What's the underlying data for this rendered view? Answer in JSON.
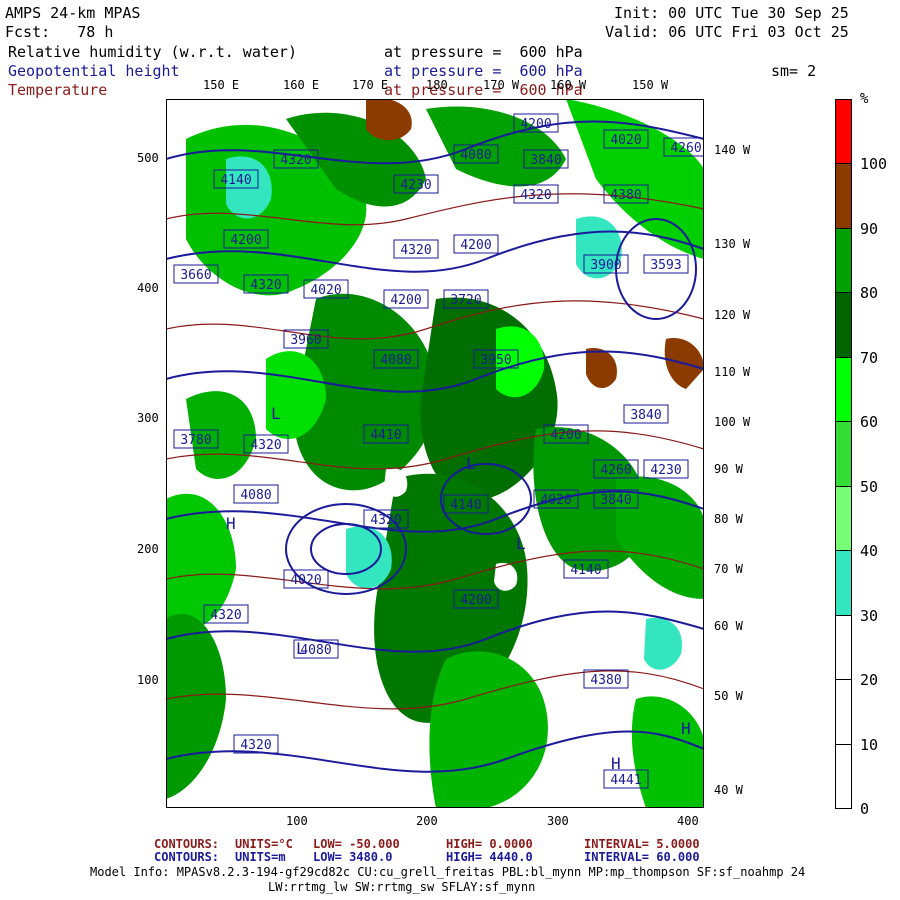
{
  "header": {
    "title": "AMPS 24-km MPAS",
    "fcst": "Fcst:   78 h",
    "init": "Init: 00 UTC Tue 30 Sep 25",
    "valid": "Valid: 06 UTC Fri 03 Oct 25",
    "sm": "sm= 2"
  },
  "fields": [
    {
      "name": "Relative humidity (w.r.t. water)",
      "level": "at pressure =  600 hPa",
      "color": "#000000"
    },
    {
      "name": "Geopotential height",
      "level": "at pressure =  600 hPa",
      "color": "#1a1a9a"
    },
    {
      "name": "Temperature",
      "level": "at pressure =  600 hPa",
      "color": "#8b1a1a"
    }
  ],
  "axes": {
    "x_ticks": [
      "100",
      "200",
      "300",
      "400"
    ],
    "y_ticks": [
      "500",
      "400",
      "300",
      "200",
      "100"
    ],
    "top_lon_labels": [
      "150 E",
      "160 E",
      "170 E",
      "180",
      "170 W",
      "160 W",
      "150 W"
    ],
    "right_lon_labels": [
      "140 W",
      "130 W",
      "120 W",
      "110 W",
      "100 W",
      "90 W",
      "80 W",
      "70 W",
      "60 W",
      "50 W",
      "40 W"
    ]
  },
  "colorbar": {
    "unit": "%",
    "labels": [
      "100",
      "90",
      "80",
      "70",
      "60",
      "50",
      "40",
      "30",
      "20",
      "10",
      "0"
    ],
    "segments": [
      {
        "color": "#ff0000"
      },
      {
        "color": "#8b3a00"
      },
      {
        "color": "#00a000"
      },
      {
        "color": "#006400"
      },
      {
        "color": "#00ff00"
      },
      {
        "color": "#33dd33"
      },
      {
        "color": "#77ff77"
      },
      {
        "color": "#33e6c0"
      },
      {
        "color": "#ffffff"
      },
      {
        "color": "#ffffff"
      },
      {
        "color": "#ffffff"
      }
    ]
  },
  "map_labels": {
    "height_labels": [
      "4200",
      "4320",
      "4140",
      "4080",
      "3840",
      "4020",
      "4260",
      "4230",
      "4320",
      "4380",
      "4200",
      "3660",
      "4320",
      "4020",
      "4320",
      "4200",
      "3900",
      "3593",
      "4200",
      "3720",
      "3960",
      "4080",
      "3950",
      "3840",
      "3780",
      "4320",
      "4410",
      "4200",
      "4260",
      "4230",
      "4080",
      "4320",
      "4140",
      "4020",
      "3840",
      "4020",
      "4140",
      "4200",
      "4320",
      "4080",
      "4380",
      "4320",
      "4441"
    ],
    "symbols": [
      "L",
      "L",
      "H",
      "H",
      "L",
      "L",
      "H"
    ]
  },
  "footer": {
    "temp_contours": {
      "label": "CONTOURS:",
      "units": "UNITS=°C",
      "low": "LOW= -50.000",
      "high": "HIGH= 0.0000",
      "interval": "INTERVAL= 5.0000"
    },
    "height_contours": {
      "label": "CONTOURS:",
      "units": "UNITS=m",
      "low": "LOW= 3480.0",
      "high": "HIGH= 4440.0",
      "interval": "INTERVAL= 60.000"
    },
    "model_info_1": "Model Info: MPASv8.2.3-194-gf29cd82c CU:cu_grell_freitas PBL:bl_mynn MP:mp_thompson SF:sf_noahmp 24",
    "model_info_2": "LW:rrtmg_lw SW:rrtmg_sw SFLAY:sf_mynn"
  }
}
